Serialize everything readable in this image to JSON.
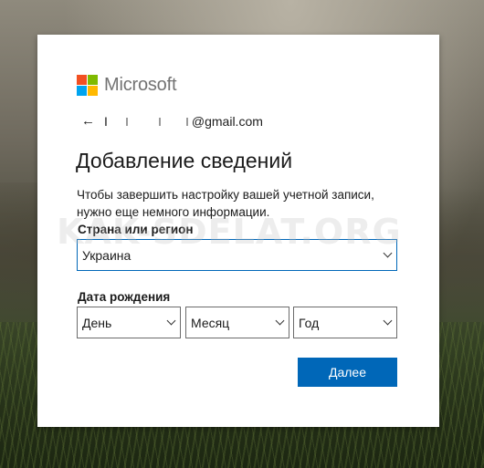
{
  "brand": {
    "name": "Microsoft",
    "squares": [
      "#f25022",
      "#7fba00",
      "#00a4ef",
      "#ffb900"
    ]
  },
  "account": {
    "email_prefix": "I",
    "email_suffix": "@gmail.com"
  },
  "page": {
    "title": "Добавление сведений",
    "description": "Чтобы завершить настройку вашей учетной записи, нужно еще немного информации."
  },
  "country": {
    "label": "Страна или регион",
    "value": "Украина"
  },
  "birthdate": {
    "label": "Дата рождения",
    "day": "День",
    "month": "Месяц",
    "year": "Год"
  },
  "next_button": "Далее",
  "watermark": "KAK-SDELAT.ORG",
  "colors": {
    "accent": "#0067b8"
  }
}
